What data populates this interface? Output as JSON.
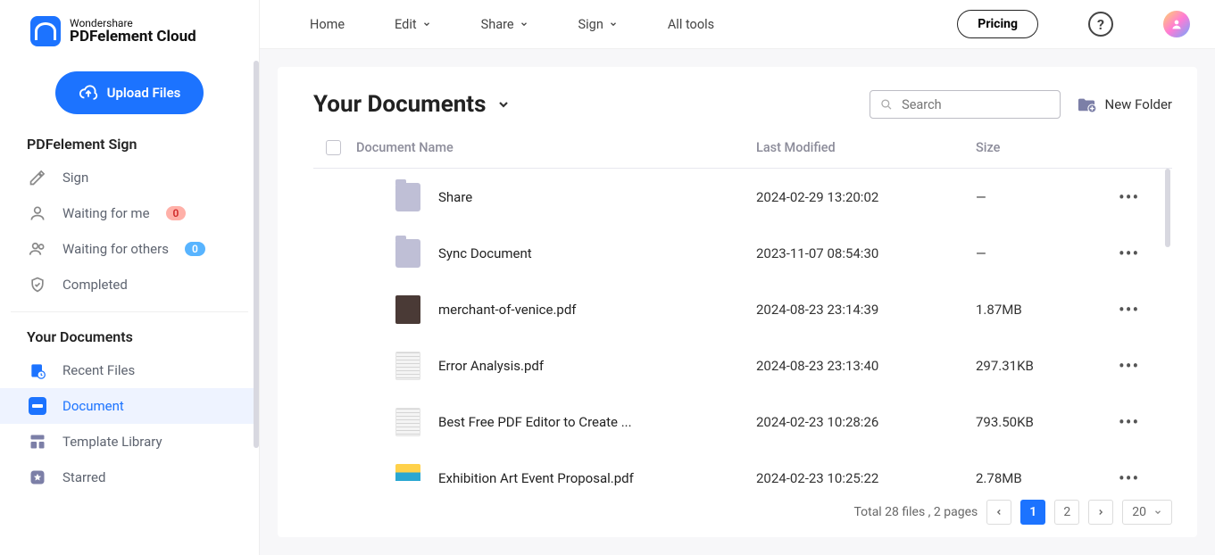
{
  "brand": {
    "small": "Wondershare",
    "big": "PDFelement Cloud"
  },
  "upload_label": "Upload Files",
  "sidebar_sections": {
    "sign_title": "PDFelement Sign",
    "docs_title": "Your Documents"
  },
  "sign_nav": [
    {
      "label": "Sign",
      "badge": null
    },
    {
      "label": "Waiting for me",
      "badge": "0",
      "badge_style": "red"
    },
    {
      "label": "Waiting for others",
      "badge": "0",
      "badge_style": "blue"
    },
    {
      "label": "Completed",
      "badge": null
    }
  ],
  "docs_nav": [
    {
      "label": "Recent Files"
    },
    {
      "label": "Document"
    },
    {
      "label": "Template Library"
    },
    {
      "label": "Starred"
    }
  ],
  "topnav": {
    "home": "Home",
    "edit": "Edit",
    "share": "Share",
    "sign": "Sign",
    "all_tools": "All tools",
    "pricing": "Pricing"
  },
  "page": {
    "title": "Your Documents",
    "search_placeholder": "Search",
    "new_folder": "New Folder"
  },
  "columns": {
    "name": "Document Name",
    "modified": "Last Modified",
    "size": "Size"
  },
  "files": [
    {
      "name": "Share",
      "modified": "2024-02-29 13:20:02",
      "size": "—",
      "kind": "folder"
    },
    {
      "name": "Sync Document",
      "modified": "2023-11-07 08:54:30",
      "size": "—",
      "kind": "folder"
    },
    {
      "name": "merchant-of-venice.pdf",
      "modified": "2024-08-23 23:14:39",
      "size": "1.87MB",
      "kind": "pdf-dark"
    },
    {
      "name": "Error Analysis.pdf",
      "modified": "2024-08-23 23:13:40",
      "size": "297.31KB",
      "kind": "pdf-light"
    },
    {
      "name": "Best Free PDF Editor to Create ...",
      "modified": "2024-02-23 10:28:26",
      "size": "793.50KB",
      "kind": "pdf-light"
    },
    {
      "name": "Exhibition Art Event Proposal.pdf",
      "modified": "2024-02-23 10:25:22",
      "size": "2.78MB",
      "kind": "pdf-color"
    }
  ],
  "pager": {
    "summary": "Total 28 files , 2 pages",
    "pages": [
      "1",
      "2"
    ],
    "page_size": "20"
  }
}
